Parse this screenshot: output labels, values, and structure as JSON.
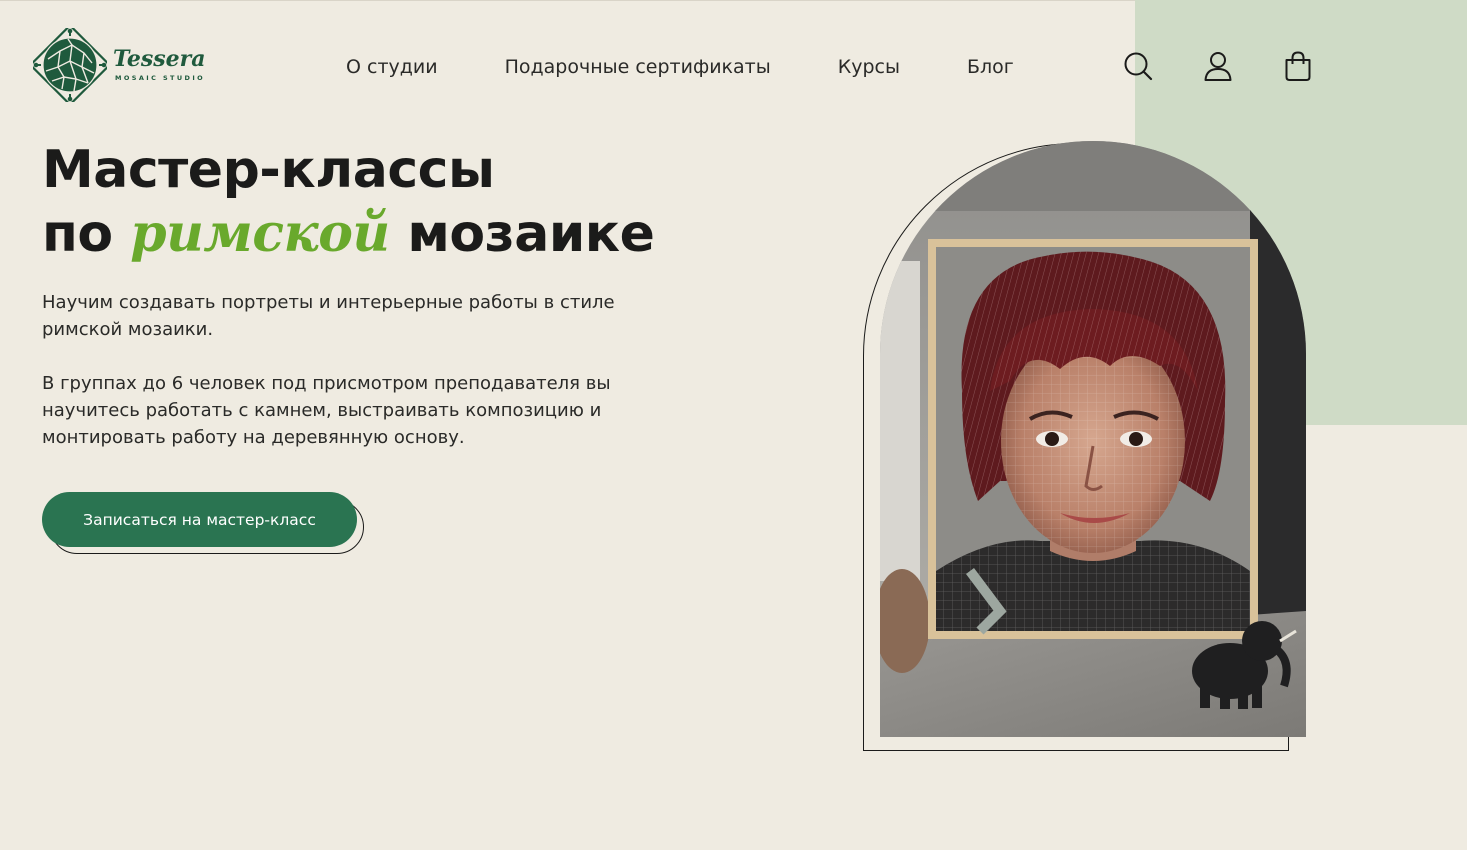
{
  "header": {
    "logo": {
      "name": "Tessera",
      "subtitle": "MOSAIC STUDIO"
    },
    "nav": [
      {
        "label": "О студии"
      },
      {
        "label": "Подарочные сертификаты"
      },
      {
        "label": "Курсы"
      },
      {
        "label": "Блог"
      }
    ],
    "icons": [
      "search-icon",
      "user-icon",
      "bag-icon"
    ]
  },
  "hero": {
    "title_line1": "Мастер-классы",
    "title_line2_before": "по ",
    "title_accent": "римской",
    "title_line2_after": " мозаике",
    "paragraph1": "Научим создавать портреты и интерьерные работы в стиле римской мозаики.",
    "paragraph2": "В группах до 6 человек под присмотром преподавателя вы научитесь работать с камнем, выстраивать композицию и монтировать работу на деревянную основу.",
    "cta_label": "Записаться на мастер-класс"
  },
  "colors": {
    "background": "#efebe1",
    "panel": "#cfdbc6",
    "brand_green": "#1f5a3d",
    "button_green": "#2a7451",
    "accent_green": "#69a92c"
  }
}
